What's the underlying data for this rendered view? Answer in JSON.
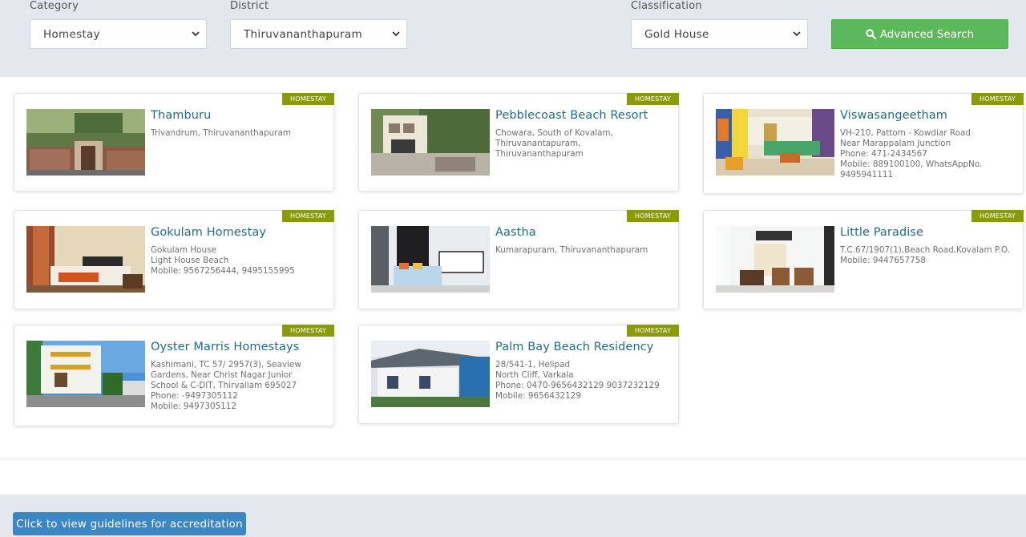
{
  "filters": {
    "category": {
      "label": "Category",
      "value": "Homestay"
    },
    "district": {
      "label": "District",
      "value": "Thiruvananthapuram"
    },
    "classification": {
      "label": "Classification",
      "value": "Gold House"
    },
    "search_button": {
      "icon": "search-icon",
      "label": "Advanced Search"
    }
  },
  "listings": [
    {
      "badge": "HOMESTAY",
      "name": "Thamburu",
      "lines": [
        "Trivandrum, Thiruvananthapuram"
      ]
    },
    {
      "badge": "HOMESTAY",
      "name": "Pebblecoast Beach Resort",
      "lines": [
        "Chowara, South of Kovalam,",
        "Thiruvanantapuram,",
        "Thiruvananthapuram"
      ]
    },
    {
      "badge": "HOMESTAY",
      "name": "Viswasangeetham",
      "lines": [
        "VH-210, Pattom - Kowdiar Road",
        "Near Marappalam Junction",
        "Phone: 471-2434567",
        "Mobile: 889100100, WhatsAppNo.",
        "9495941111"
      ]
    },
    {
      "badge": "HOMESTAY",
      "name": "Gokulam Homestay",
      "lines": [
        "Gokulam House",
        "Light House Beach",
        "Mobile: 9567256444, 9495155995"
      ]
    },
    {
      "badge": "HOMESTAY",
      "name": "Aastha",
      "lines": [
        "Kumarapuram, Thiruvananthapuram"
      ]
    },
    {
      "badge": "HOMESTAY",
      "name": "Little Paradise",
      "lines": [
        "T.C.67/1907(1),Beach Road,Kovalam P.O.",
        "Mobile: 9447657758"
      ]
    },
    {
      "badge": "HOMESTAY",
      "name": "Oyster Marris Homestays",
      "lines": [
        "Kashimani, TC 57/ 2957(3), Seaview",
        "Gardens, Near Christ Nagar Junior",
        "School & C-DIT, Thirvallam 695027",
        "Phone: -9497305112",
        "Mobile: 9497305112"
      ]
    },
    {
      "badge": "HOMESTAY",
      "name": "Palm Bay Beach Residency",
      "lines": [
        "28/541-1, Helipad",
        "North Cliff, Varkala",
        "Phone: 0470-9656432129 9037232129",
        "Mobile: 9656432129"
      ]
    }
  ],
  "footer": {
    "guidelines_button": "Click to view guidelines for accreditation"
  },
  "colors": {
    "filter_bg": "#e3e8ef",
    "search_green": "#5cb85c",
    "badge_olive": "#8a9a08",
    "title_blue": "#1d6a8c",
    "guide_blue": "#3b87c4"
  }
}
